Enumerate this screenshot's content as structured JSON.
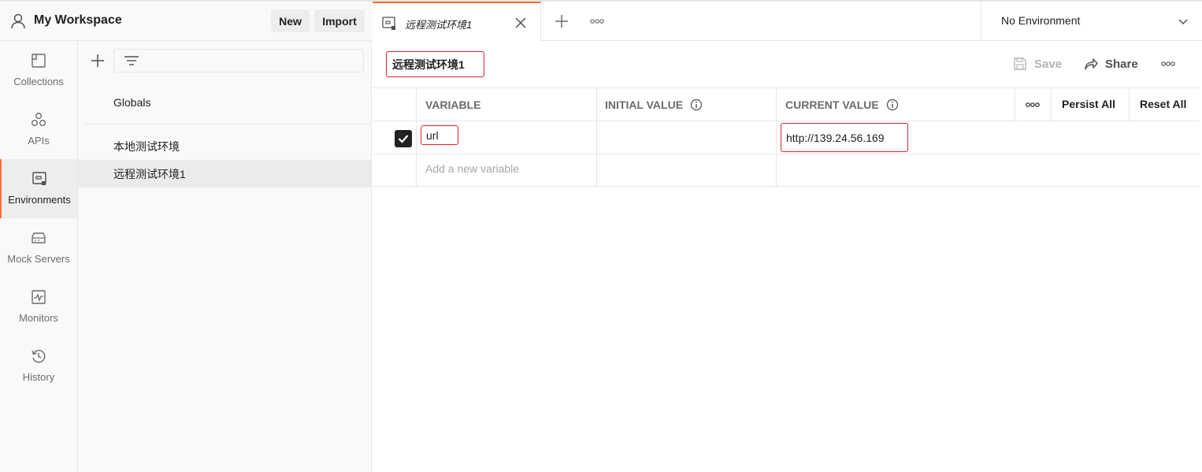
{
  "workspace": {
    "title": "My Workspace",
    "new_label": "New",
    "import_label": "Import"
  },
  "rail": {
    "items": [
      {
        "label": "Collections",
        "icon": "collections-icon"
      },
      {
        "label": "APIs",
        "icon": "apis-icon"
      },
      {
        "label": "Environments",
        "icon": "environments-icon",
        "active": true
      },
      {
        "label": "Mock Servers",
        "icon": "mock-servers-icon"
      },
      {
        "label": "Monitors",
        "icon": "monitors-icon"
      },
      {
        "label": "History",
        "icon": "history-icon"
      }
    ]
  },
  "env_list": {
    "globals": "Globals",
    "items": [
      "本地测试环境",
      "远程测试环境1"
    ],
    "active_index": 1
  },
  "tabs": {
    "active_title": "远程测试环境1",
    "environment_selector": "No Environment"
  },
  "editor": {
    "env_name": "远程测试环境1",
    "save_label": "Save",
    "share_label": "Share",
    "columns": {
      "variable": "VARIABLE",
      "initial_value": "INITIAL VALUE",
      "current_value": "CURRENT VALUE",
      "persist_all": "Persist All",
      "reset_all": "Reset All"
    },
    "rows": [
      {
        "checked": true,
        "variable": "url",
        "initial_value": "",
        "current_value": "http://139.24.56.169"
      }
    ],
    "add_placeholder": "Add a new variable"
  },
  "colors": {
    "accent": "#ff6c37",
    "highlight_border": "#d8262a",
    "sidebar_bg": "#f9f9f9"
  }
}
